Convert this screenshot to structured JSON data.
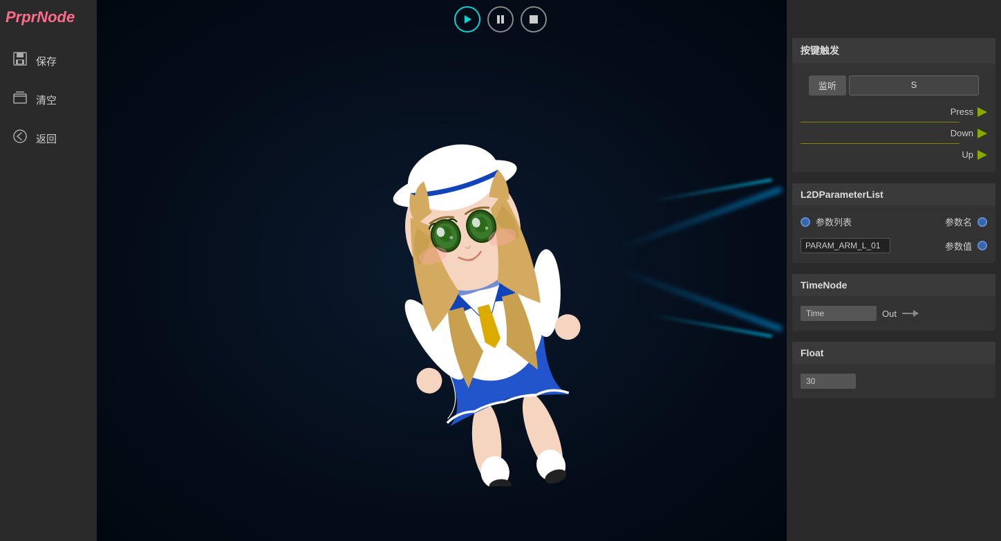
{
  "app": {
    "logo": "PrprNode",
    "logo_color": "#ff6b8a"
  },
  "toolbar": {
    "play_label": "▶",
    "pause_label": "⏸",
    "stop_label": "⏹"
  },
  "sidebar": {
    "items": [
      {
        "id": "save",
        "label": "保存",
        "icon": "💾"
      },
      {
        "id": "clear",
        "label": "清空",
        "icon": "📁"
      },
      {
        "id": "back",
        "label": "返回",
        "icon": "←"
      }
    ]
  },
  "right_panel": {
    "key_trigger": {
      "title": "按键触发",
      "listen_btn": "监听",
      "key_btn": "S",
      "press_label": "Press",
      "down_label": "Down",
      "up_label": "Up"
    },
    "l2d_param": {
      "title": "L2DParameterList",
      "param_list_label": "参数列表",
      "param_name_label": "参数名",
      "param_input_value": "PARAM_ARM_L_01",
      "param_value_label": "参数值"
    },
    "time_node": {
      "title": "TimeNode",
      "time_input_value": "Time",
      "out_label": "Out"
    },
    "float_node": {
      "title": "Float",
      "value": "30"
    }
  }
}
